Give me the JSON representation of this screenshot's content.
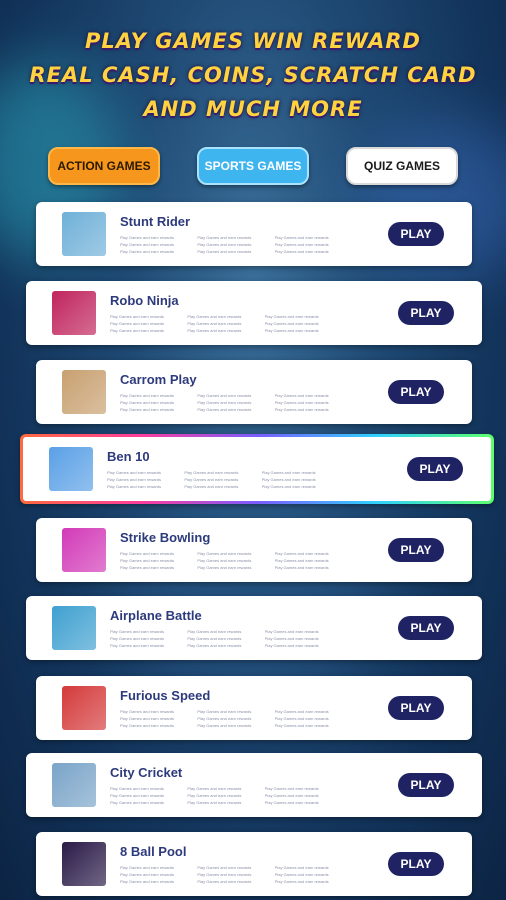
{
  "header": {
    "line1": "PLAY GAMES WIN REWARD",
    "line2": "REAL CASH, COINS, SCRATCH CARD",
    "line3": "AND MUCH MORE"
  },
  "tabs": [
    {
      "label": "ACTION GAMES",
      "color": "#f6961d"
    },
    {
      "label": "SPORTS GAMES",
      "color": "#3fb5ef"
    },
    {
      "label": "QUIZ GAMES",
      "color": "#ffffff"
    }
  ],
  "play_label": "PLAY",
  "desc_text": "Play Games and earn rewards",
  "games": [
    {
      "title": "Stunt Rider",
      "thumb_color": "#6fb0d8",
      "icon": "stunt-rider-thumb"
    },
    {
      "title": "Robo Ninja",
      "thumb_color": "#c0245c",
      "icon": "robo-ninja-thumb"
    },
    {
      "title": "Carrom Play",
      "thumb_color": "#c8a070",
      "icon": "carrom-thumb"
    },
    {
      "title": "Ben 10",
      "thumb_color": "#5aa0e6",
      "icon": "ben10-thumb"
    },
    {
      "title": "Strike Bowling",
      "thumb_color": "#d23ab8",
      "icon": "bowling-thumb"
    },
    {
      "title": "Airplane Battle",
      "thumb_color": "#3fa0d0",
      "icon": "airplane-thumb"
    },
    {
      "title": "Furious Speed",
      "thumb_color": "#d43a3a",
      "icon": "speed-thumb"
    },
    {
      "title": "City Cricket",
      "thumb_color": "#7aa4c8",
      "icon": "cricket-thumb"
    },
    {
      "title": "8 Ball Pool",
      "thumb_color": "#2a1a48",
      "icon": "pool-thumb"
    }
  ]
}
